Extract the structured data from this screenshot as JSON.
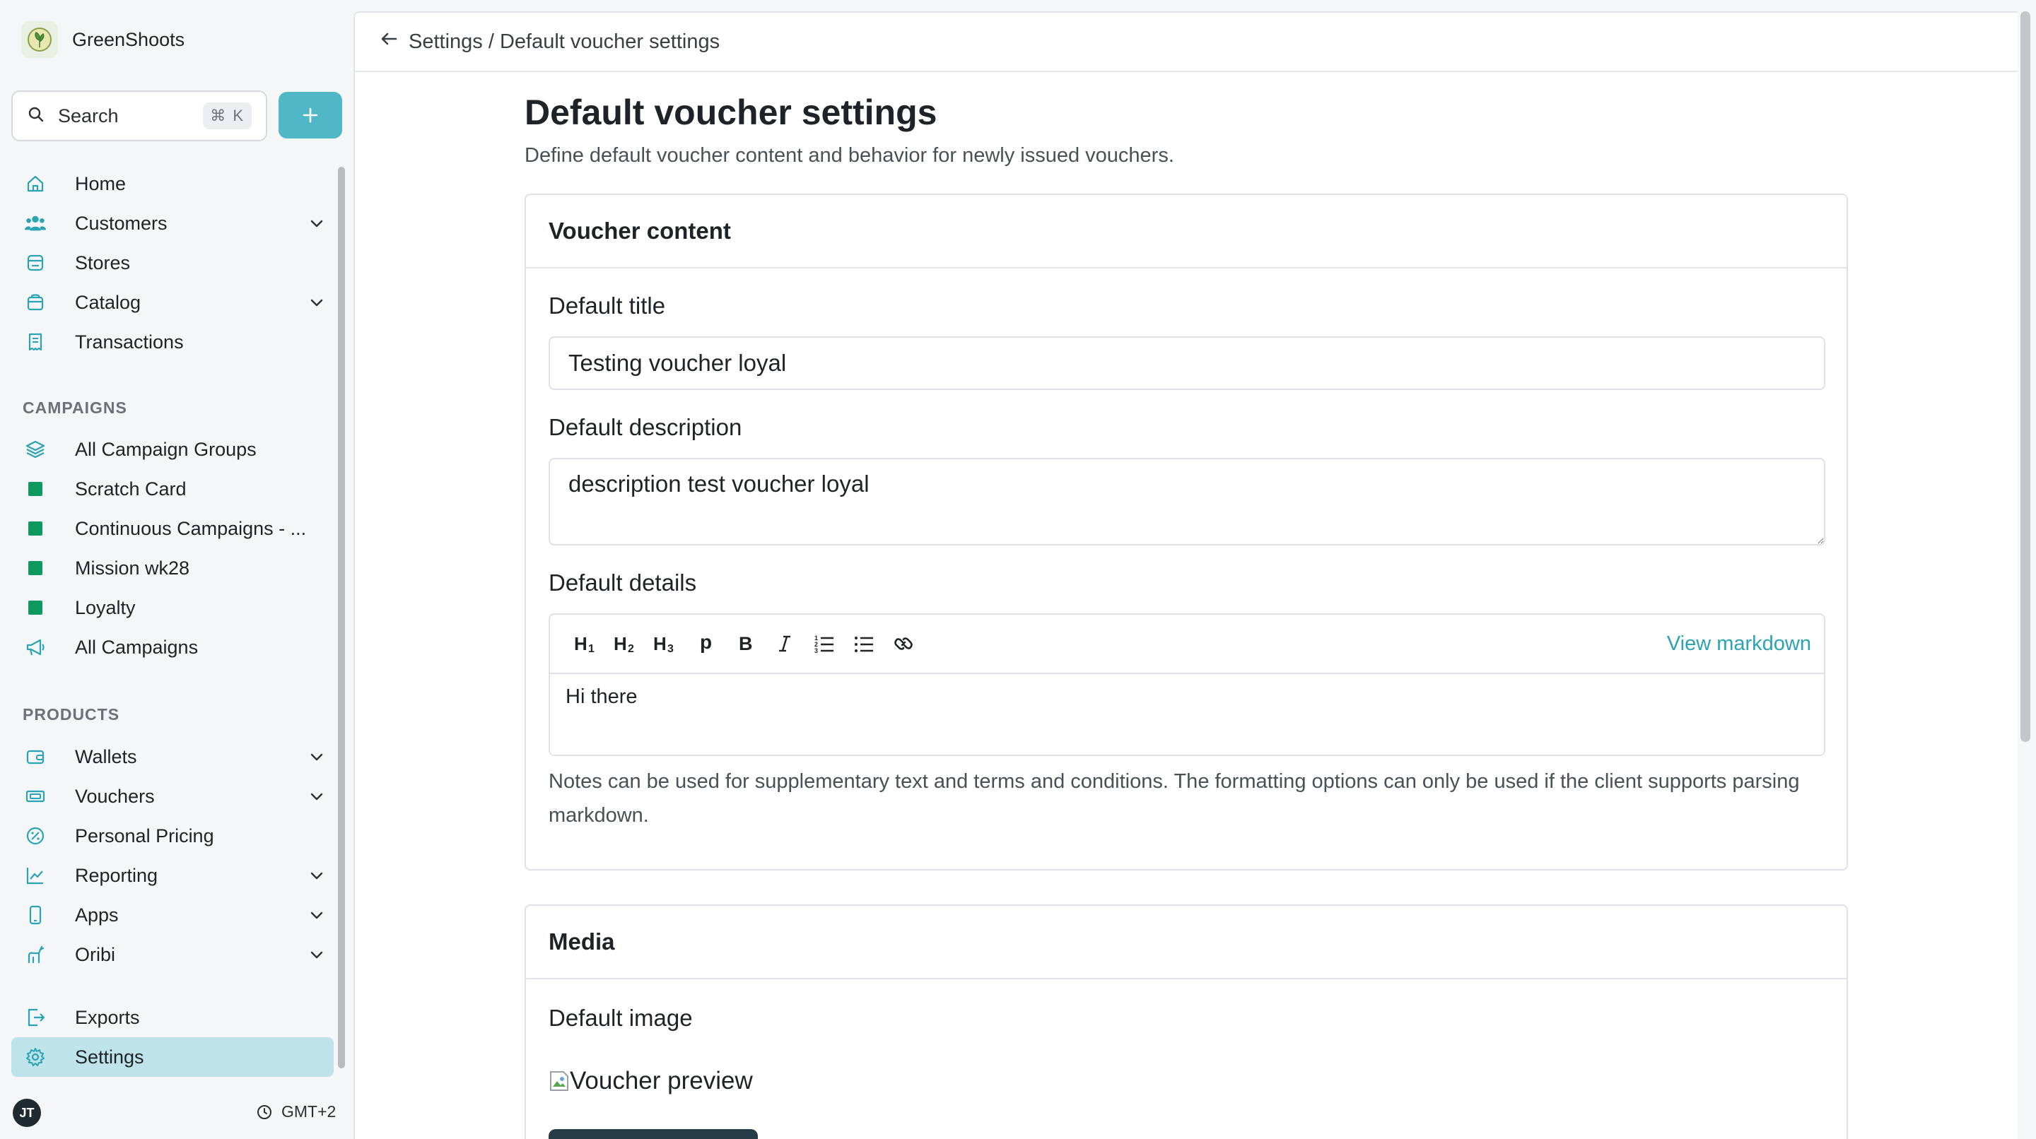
{
  "app": {
    "name": "GreenShoots"
  },
  "sidebar": {
    "search_label": "Search",
    "search_shortcut": "⌘ K",
    "main_items": [
      {
        "label": "Home",
        "icon": "home-icon",
        "has_children": false
      },
      {
        "label": "Customers",
        "icon": "users-icon",
        "has_children": true
      },
      {
        "label": "Stores",
        "icon": "store-icon",
        "has_children": false
      },
      {
        "label": "Catalog",
        "icon": "bag-icon",
        "has_children": true
      },
      {
        "label": "Transactions",
        "icon": "receipt-icon",
        "has_children": false
      }
    ],
    "campaigns_section": "CAMPAIGNS",
    "campaign_items": [
      {
        "label": "All Campaign Groups",
        "icon": "layers-icon"
      },
      {
        "label": "Scratch Card",
        "icon": "square-icon"
      },
      {
        "label": "Continuous Campaigns - ...",
        "icon": "square-icon"
      },
      {
        "label": "Mission wk28",
        "icon": "square-icon"
      },
      {
        "label": "Loyalty",
        "icon": "square-icon"
      },
      {
        "label": "All Campaigns",
        "icon": "megaphone-icon"
      }
    ],
    "products_section": "PRODUCTS",
    "product_items": [
      {
        "label": "Wallets",
        "icon": "wallet-icon",
        "has_children": true
      },
      {
        "label": "Vouchers",
        "icon": "ticket-icon",
        "has_children": true
      },
      {
        "label": "Personal Pricing",
        "icon": "percent-icon",
        "has_children": false
      },
      {
        "label": "Reporting",
        "icon": "chart-icon",
        "has_children": true
      },
      {
        "label": "Apps",
        "icon": "phone-icon",
        "has_children": true
      },
      {
        "label": "Oribi",
        "icon": "animal-icon",
        "has_children": true
      }
    ],
    "bottom_items": [
      {
        "label": "Exports",
        "icon": "export-icon",
        "active": false
      },
      {
        "label": "Settings",
        "icon": "gear-icon",
        "active": true
      }
    ],
    "user_initials": "JT",
    "timezone": "GMT+2",
    "accent_color": "#4fb7c6",
    "active_bg": "#bfe3ea",
    "campaign_color": "#0f9960"
  },
  "header": {
    "breadcrumb": "Settings / Default voucher settings"
  },
  "page": {
    "title": "Default voucher settings",
    "subtitle": "Define default voucher content and behavior for newly issued vouchers."
  },
  "voucher_content": {
    "heading": "Voucher content",
    "title_label": "Default title",
    "title_value": "Testing voucher loyal",
    "description_label": "Default description",
    "description_value": "description test voucher loyal",
    "details_label": "Default details",
    "toolbar": [
      "H1",
      "H2",
      "H3",
      "p",
      "B",
      "I",
      "ordered-list",
      "bullet-list",
      "link"
    ],
    "view_markdown": "View markdown",
    "details_value": "Hi there",
    "help_text": "Notes can be used for supplementary text and terms and conditions. The formatting options can only be used if the client supports parsing markdown."
  },
  "media": {
    "heading": "Media",
    "image_label": "Default image",
    "image_alt": "Voucher preview"
  }
}
